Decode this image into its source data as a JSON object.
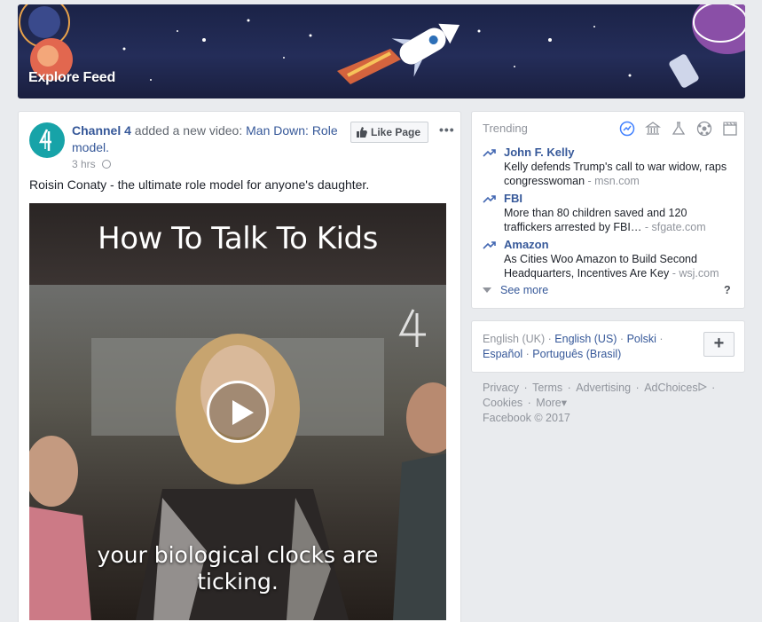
{
  "banner": {
    "title": "Explore Feed"
  },
  "post": {
    "page_name": "Channel 4",
    "action": "added a new video:",
    "video_link": "Man Down: Role model.",
    "time": "3 hrs",
    "like_page_label": "Like Page",
    "text": "Roisin Conaty - the ultimate role model for anyone's daughter.",
    "video": {
      "title_overlay": "How To Talk To Kids",
      "caption_line1": "your biological clocks are",
      "caption_line2": "ticking."
    }
  },
  "trending": {
    "title": "Trending",
    "icons": [
      "trending-icon",
      "politics-icon",
      "science-icon",
      "sports-icon",
      "entertainment-icon"
    ],
    "items": [
      {
        "name": "John F. Kelly",
        "desc": "Kelly defends Trump's call to war widow, raps congresswoman",
        "source": "- msn.com"
      },
      {
        "name": "FBI",
        "desc": "More than 80 children saved and 120 traffickers arrested by FBI…",
        "source": "- sfgate.com"
      },
      {
        "name": "Amazon",
        "desc": "As Cities Woo Amazon to Build Second Headquarters, Incentives Are Key",
        "source": "- wsj.com"
      }
    ],
    "see_more": "See more",
    "help": "?"
  },
  "languages": {
    "current": "English (UK)",
    "options": [
      "English (US)",
      "Polski",
      "Español",
      "Português (Brasil)"
    ],
    "add_label": "+"
  },
  "footer": {
    "links": [
      "Privacy",
      "Terms",
      "Advertising",
      "AdChoices",
      "Cookies",
      "More"
    ],
    "copyright": "Facebook © 2017"
  },
  "colors": {
    "link": "#365899",
    "muted": "#90949c",
    "background": "#e9ebee",
    "channel4": "#17a3a8"
  }
}
